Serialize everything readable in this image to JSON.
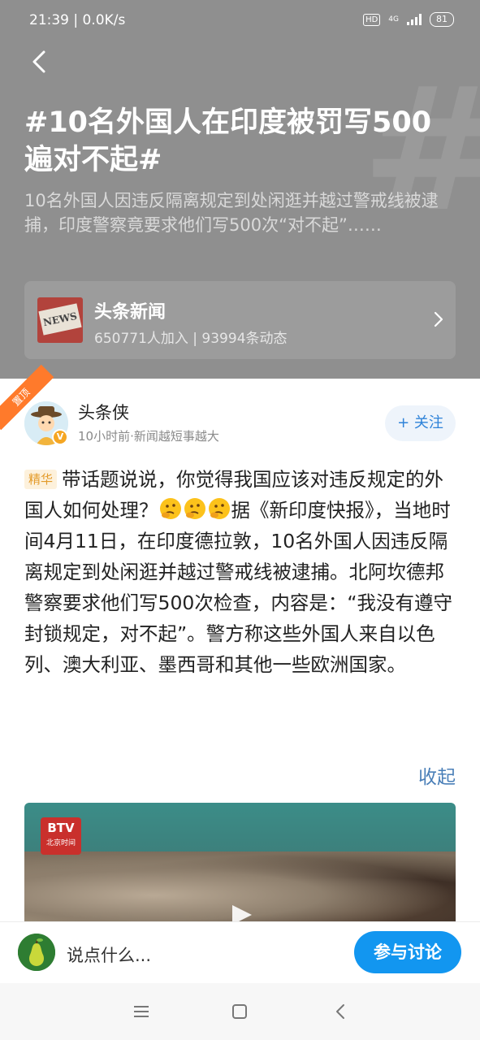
{
  "status_bar": {
    "time": "21:39",
    "speed": "0.0K/s",
    "hd": "HD",
    "network": "4G",
    "battery": "81"
  },
  "topic": {
    "title": "#10名外国人在印度被罚写500遍对不起#",
    "description": "10名外国人因违反隔离规定到处闲逛并越过警戒线被逮捕，印度警察竟要求他们写500次“对不起”……",
    "watermark": "#"
  },
  "channel": {
    "logo_text": "NEWS",
    "name": "头条新闻",
    "stats": "650771人加入 | 93994条动态"
  },
  "post": {
    "pin_label": "置顶",
    "author": "头条侠",
    "meta": "10小时前·新闻越短事越大",
    "follow_label": "+ 关注",
    "tag": "精华",
    "text_part1": "带话题说说，你觉得我国应该对违反规定的外国人如何处理？",
    "text_part2": "据《新印度快报》，当地时间4月11日，在印度德拉敦，10名外国人因违反隔离规定到处闲逛并越过警戒线被逮捕。北阿坎德邦警察要求他们写500次检查，内容是：“我没有遵守封锁规定，对不起”。警方称这些外国人来自以色列、澳大利亚、墨西哥和其他一些欧洲国家。",
    "collapse_label": "收起",
    "video_logo_top": "BTV",
    "video_logo_bottom": "北京时间"
  },
  "comment_bar": {
    "placeholder": "说点什么...",
    "discuss_label": "参与讨论"
  },
  "colors": {
    "hero_bg": "#8f8f8f",
    "accent_blue": "#1296f0",
    "pin_orange": "#ff7a2b",
    "tag_orange": "#e39b2a"
  }
}
